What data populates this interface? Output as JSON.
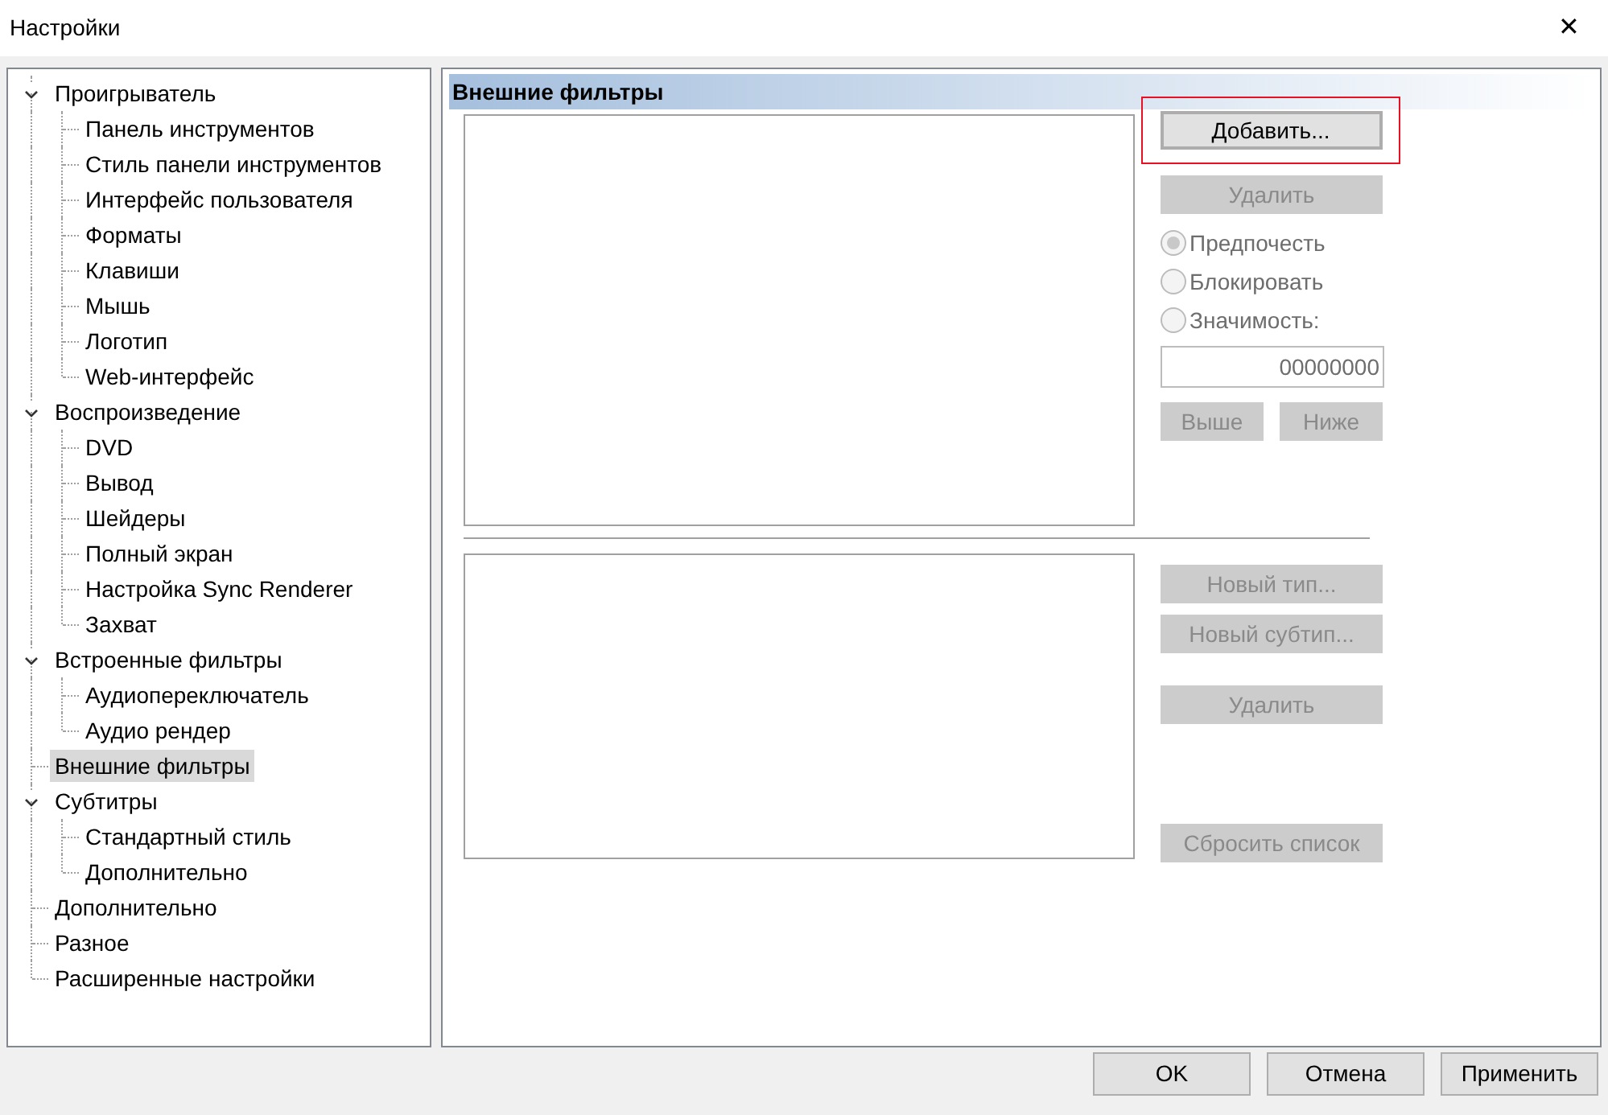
{
  "window": {
    "title": "Настройки",
    "close": "✕"
  },
  "tree": [
    {
      "label": "Проигрыватель",
      "expanded": true,
      "selected": false,
      "children": [
        {
          "label": "Панель инструментов",
          "selected": false
        },
        {
          "label": "Стиль панели инструментов",
          "selected": false
        },
        {
          "label": "Интерфейс пользователя",
          "selected": false
        },
        {
          "label": "Форматы",
          "selected": false
        },
        {
          "label": "Клавиши",
          "selected": false
        },
        {
          "label": "Мышь",
          "selected": false
        },
        {
          "label": "Логотип",
          "selected": false
        },
        {
          "label": "Web-интерфейс",
          "selected": false
        }
      ]
    },
    {
      "label": "Воспроизведение",
      "expanded": true,
      "selected": false,
      "children": [
        {
          "label": "DVD",
          "selected": false
        },
        {
          "label": "Вывод",
          "selected": false
        },
        {
          "label": "Шейдеры",
          "selected": false
        },
        {
          "label": "Полный экран",
          "selected": false
        },
        {
          "label": "Настройка Sync Renderer",
          "selected": false
        },
        {
          "label": "Захват",
          "selected": false
        }
      ]
    },
    {
      "label": "Встроенные фильтры",
      "expanded": true,
      "selected": false,
      "children": [
        {
          "label": "Аудиопереключатель",
          "selected": false
        },
        {
          "label": "Аудио рендер",
          "selected": false
        }
      ]
    },
    {
      "label": "Внешние фильтры",
      "selected": true
    },
    {
      "label": "Субтитры",
      "expanded": true,
      "selected": false,
      "children": [
        {
          "label": "Стандартный стиль",
          "selected": false
        },
        {
          "label": "Дополнительно",
          "selected": false
        }
      ]
    },
    {
      "label": "Дополнительно",
      "selected": false
    },
    {
      "label": "Разное",
      "selected": false
    },
    {
      "label": "Расширенные настройки",
      "selected": false
    }
  ],
  "page": {
    "title": "Внешние фильтры",
    "filter_buttons": [
      {
        "label": "Добавить...",
        "disabled": false,
        "focused": true,
        "highlighted": true
      },
      {
        "label": "Удалить",
        "disabled": true,
        "focused": false,
        "highlighted": false
      }
    ],
    "radios": [
      {
        "label": "Предпочесть",
        "selected": true,
        "disabled": true
      },
      {
        "label": "Блокировать",
        "selected": false,
        "disabled": true
      },
      {
        "label": "Значимость:",
        "selected": false,
        "disabled": true
      }
    ],
    "merit_field": {
      "value": "00000000"
    },
    "order_buttons": [
      {
        "label": "Выше",
        "disabled": true
      },
      {
        "label": "Ниже",
        "disabled": true
      }
    ],
    "type_buttons": [
      {
        "label": "Новый тип...",
        "disabled": true
      },
      {
        "label": "Новый субтип...",
        "disabled": true
      },
      {
        "label": "Удалить",
        "disabled": true
      },
      {
        "label": "Сбросить список",
        "disabled": true
      }
    ]
  },
  "footer_buttons": [
    {
      "label": "OK",
      "disabled": false
    },
    {
      "label": "Отмена",
      "disabled": false
    },
    {
      "label": "Применить",
      "disabled": false
    }
  ]
}
